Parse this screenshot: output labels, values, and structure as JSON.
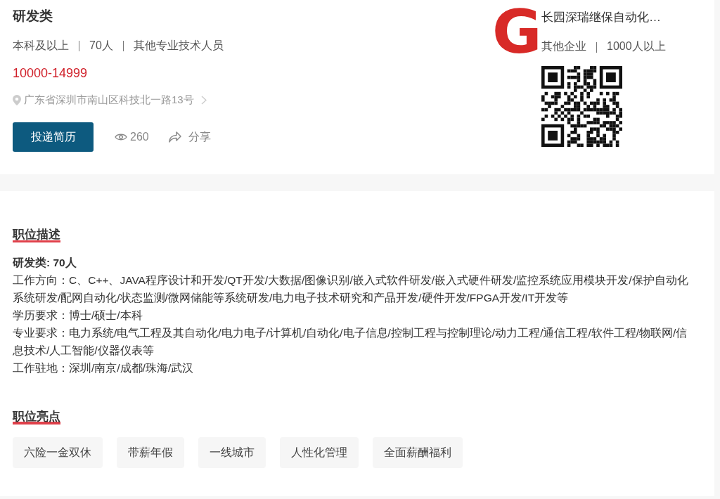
{
  "job": {
    "title": "研发类",
    "meta": [
      "本科及以上",
      "70人",
      "其他专业技术人员"
    ],
    "salary": "10000-14999",
    "address": "广东省深圳市南山区科技北一路13号",
    "apply_button": "投递简历",
    "views": "260",
    "share": "分享"
  },
  "company": {
    "logo": "G",
    "name": "长园深瑞继保自动化…",
    "meta": [
      "其他企业",
      "1000人以上"
    ]
  },
  "description": {
    "title": "职位描述",
    "lines": [
      {
        "kind": "heading",
        "text": "研发类: 70人"
      },
      {
        "kind": "line",
        "text": "工作方向：C、C++、JAVA程序设计和开发/QT开发/大数据/图像识别/嵌入式软件研发/嵌入式硬件研发/监控系统应用模块开发/保护自动化系统研发/配网自动化/状态监测/微网储能等系统研发/电力电子技术研究和产品开发/硬件开发/FPGA开发/IT开发等"
      },
      {
        "kind": "line",
        "text": "学历要求：博士/硕士/本科"
      },
      {
        "kind": "line",
        "text": "专业要求：电力系统/电气工程及其自动化/电力电子/计算机/自动化/电子信息/控制工程与控制理论/动力工程/通信工程/软件工程/物联网/信息技术/人工智能/仪器仪表等"
      },
      {
        "kind": "line",
        "text": "工作驻地：深圳/南京/成都/珠海/武汉"
      }
    ]
  },
  "highlights": {
    "title": "职位亮点",
    "tags": [
      "六险一金双休",
      "带薪年假",
      "一线城市",
      "人性化管理",
      "全面薪酬福利"
    ]
  }
}
